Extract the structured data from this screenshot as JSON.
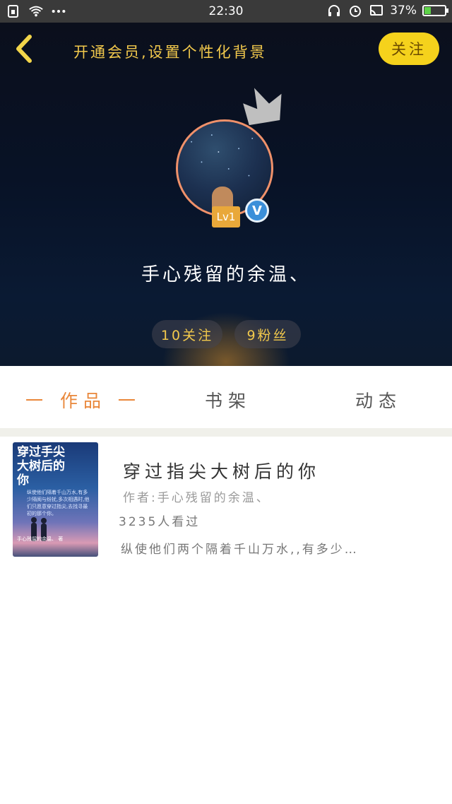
{
  "status_bar": {
    "time": "22:30",
    "battery_text": "37%",
    "battery_level": 0.37,
    "battery_color": "#5fd34a"
  },
  "header": {
    "back_icon": "chevron-left-icon",
    "vip_text": "开通会员,设置个性化背景",
    "follow_label": "关注",
    "follow_color": "#f5d21c",
    "avatar_level": "Lv1",
    "verified_mark": "V",
    "username": "手心残留的余温、",
    "following_label": "10关注",
    "fans_label": "9粉丝"
  },
  "tabs": [
    {
      "label": "一 作品 一",
      "active": true
    },
    {
      "label": "书架",
      "active": false
    },
    {
      "label": "动态",
      "active": false
    }
  ],
  "accent_color": "#e9873a",
  "book": {
    "cover_title": "穿过手尖大树后的你",
    "cover_blurb": "纵使他们隔着千山万水,有多少隔阂与纷扰,多次相遇时,他们只愿意穿过指尖,去找寻最初的那个你。",
    "cover_author": "手心残留的余温、 著",
    "title": "穿过指尖大树后的你",
    "author": "作者:手心残留的余温、",
    "views": "3235人看过",
    "description": "纵使他们两个隔着千山万水,,有多少…"
  }
}
